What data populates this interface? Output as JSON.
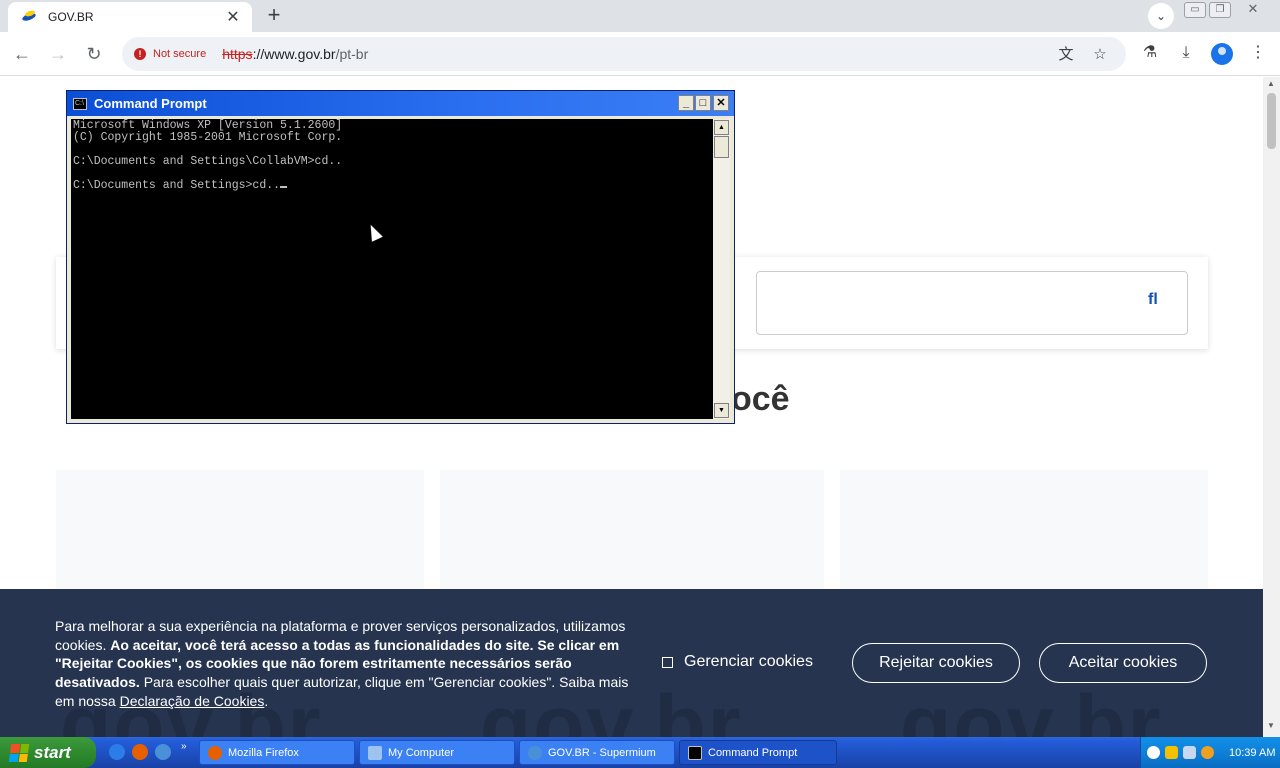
{
  "browser": {
    "tab_title": "GOV.BR",
    "tab_close": "✕",
    "new_tab": "+",
    "url_scheme": "https",
    "url_host": "://www.gov.br",
    "url_path": "/pt-br",
    "security_label": "Not secure",
    "back": "←",
    "forward": "→",
    "reload": "↻"
  },
  "page": {
    "section_heading_fragment": "ocê",
    "search_glyph": "fl"
  },
  "cookie_banner": {
    "text_1": "Para melhorar a sua experiência na plataforma e prover serviços personalizados, utilizamos cookies. ",
    "text_bold_1": "Ao aceitar, você terá acesso a todas as funcionalidades do site. Se clicar em \"Rejeitar Cookies\", os cookies que não forem estritamente necessários serão desativados.",
    "text_2": " Para escolher quais quer autorizar, clique em \"Gerenciar cookies\". Saiba mais em nossa ",
    "link": "Declaração de Cookies",
    "text_end": ".",
    "manage_label": "Gerenciar cookies",
    "reject_label": "Rejeitar cookies",
    "accept_label": "Aceitar cookies",
    "watermark": "gov.br"
  },
  "cmd": {
    "title": "Command Prompt",
    "lines": [
      "Microsoft Windows XP [Version 5.1.2600]",
      "(C) Copyright 1985-2001 Microsoft Corp.",
      "C:\\Documents and Settings\\CollabVM>cd..",
      "C:\\Documents and Settings>cd.."
    ],
    "minimize": "_",
    "maximize": "□",
    "close": "✕"
  },
  "taskbar": {
    "start_label": "start",
    "tasks": [
      "Mozilla Firefox",
      "My Computer",
      "GOV.BR - Supermium",
      "Command Prompt"
    ],
    "clock": "10:39 AM"
  },
  "colors": {
    "cookie_bg": "#26344f",
    "gov_blue": "#1351b4",
    "xp_title": "#0a4fd6",
    "taskbar": "#245edb"
  }
}
